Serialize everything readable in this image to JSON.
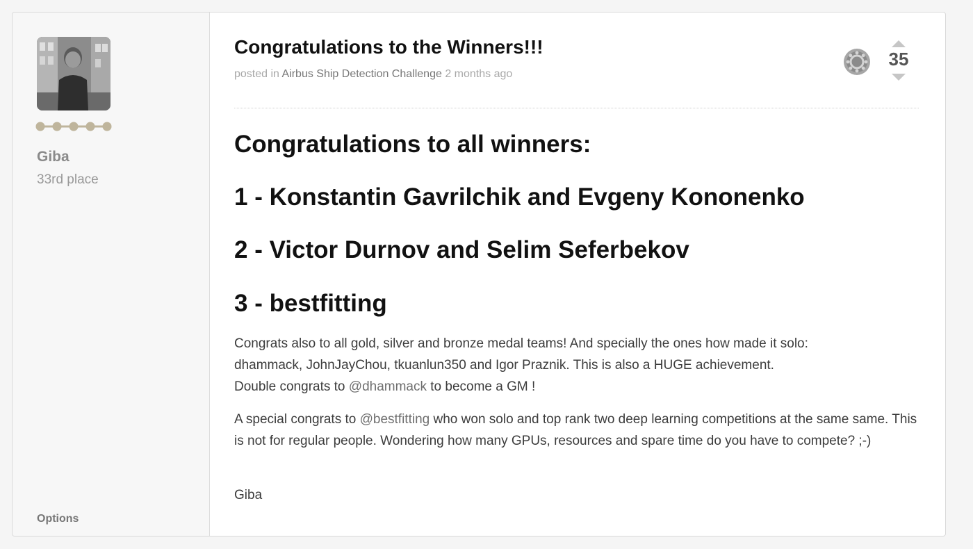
{
  "author": {
    "name": "Giba",
    "rank": "33rd place",
    "options_label": "Options",
    "tier_color": "#bfb59c"
  },
  "post": {
    "title": "Congratulations to the Winners!!!",
    "meta": {
      "prefix": "posted in",
      "competition": "Airbus Ship Detection Challenge",
      "time": "2 months ago"
    },
    "medal_icon": "gear-medal-icon",
    "votes": "35",
    "headings": [
      "Congratulations to all winners:",
      "1 - Konstantin Gavrilchik and Evgeny Kononenko",
      "2 - Victor Durnov and Selim Seferbekov",
      "3 - bestfitting"
    ],
    "paragraph1": {
      "line1": "Congrats also to all gold, silver and bronze medal teams! And specially the ones how made it solo:",
      "line2": "dhammack, JohnJayChou, tkuanlun350 and Igor Praznik. This is also a HUGE achievement.",
      "line3_prefix": "Double congrats to",
      "line3_mention": "@dhammack",
      "line3_suffix": "to become a GM !"
    },
    "paragraph2": {
      "prefix": "A special congrats to",
      "mention": "@bestfitting",
      "suffix": "who won solo and top rank two deep learning competitions at the same same. This is not for regular people. Wondering how many GPUs, resources and spare time do you have to compete? ;-)"
    },
    "signature": "Giba"
  }
}
